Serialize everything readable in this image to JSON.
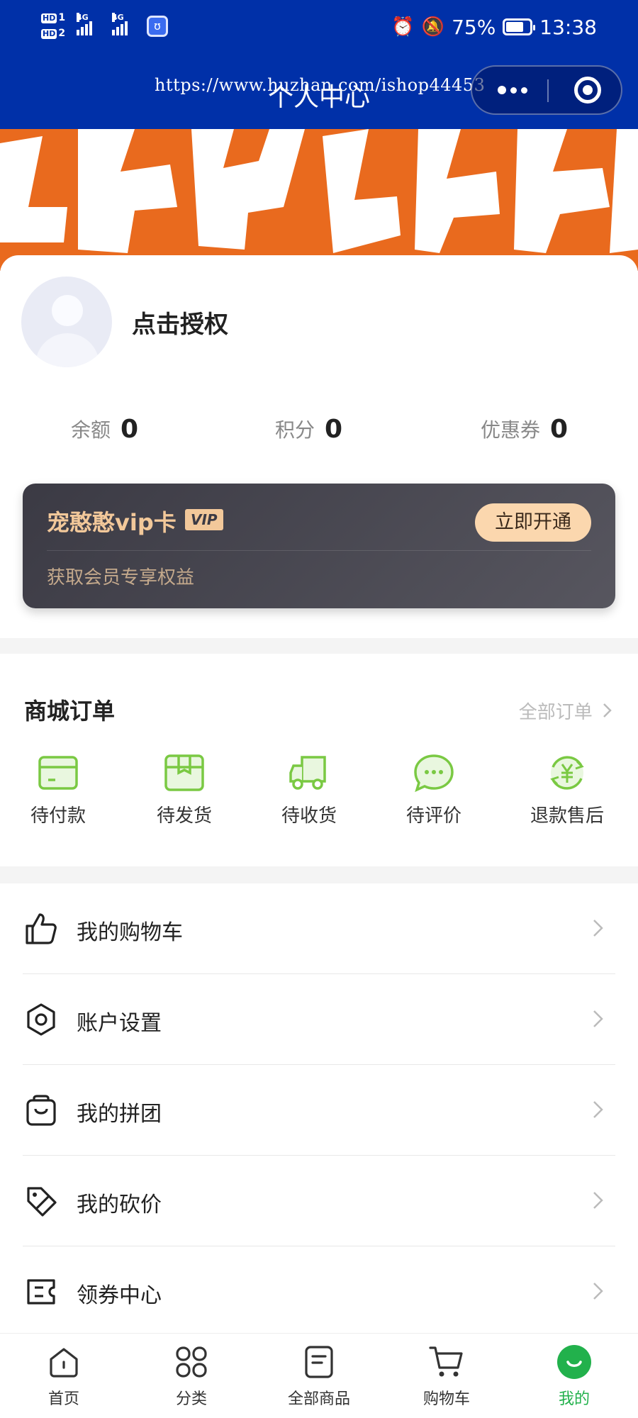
{
  "status_bar": {
    "battery": "75%",
    "time": "13:38",
    "network_1": "4G",
    "network_2": "4G",
    "hd1": "HD",
    "hd2": "HD",
    "sim1": "1",
    "sim2": "2",
    "app_icon": "ʊ"
  },
  "header": {
    "title": "个人中心",
    "watermark": "https://www.huzhan.com/ishop44453"
  },
  "profile": {
    "auth_text": "点击授权",
    "stats": [
      {
        "label": "余额",
        "value": "0"
      },
      {
        "label": "积分",
        "value": "0"
      },
      {
        "label": "优惠券",
        "value": "0"
      }
    ]
  },
  "vip": {
    "title": "宠憨憨vip卡",
    "badge": "VIP",
    "button": "立即开通",
    "subtitle": "获取会员专享权益"
  },
  "orders": {
    "title": "商城订单",
    "all_link": "全部订单",
    "items": [
      {
        "label": "待付款",
        "icon": "wallet-icon"
      },
      {
        "label": "待发货",
        "icon": "box-icon"
      },
      {
        "label": "待收货",
        "icon": "truck-icon"
      },
      {
        "label": "待评价",
        "icon": "chat-icon"
      },
      {
        "label": "退款售后",
        "icon": "refund-icon"
      }
    ]
  },
  "menu": [
    {
      "label": "我的购物车",
      "icon": "thumbs-up-icon"
    },
    {
      "label": "账户设置",
      "icon": "settings-icon"
    },
    {
      "label": "我的拼团",
      "icon": "bag-icon"
    },
    {
      "label": "我的砍价",
      "icon": "discount-tag-icon"
    },
    {
      "label": "领券中心",
      "icon": "coupon-icon"
    }
  ],
  "tabbar": [
    {
      "label": "首页",
      "icon": "home-icon"
    },
    {
      "label": "分类",
      "icon": "category-icon"
    },
    {
      "label": "全部商品",
      "icon": "document-icon"
    },
    {
      "label": "购物车",
      "icon": "cart-icon"
    },
    {
      "label": "我的",
      "icon": "smile-icon",
      "active": true
    }
  ],
  "colors": {
    "header_bg": "#0030a8",
    "banner_bg": "#e96a1e",
    "accent_green": "#22b14c",
    "vip_gold": "#f2c89a"
  }
}
